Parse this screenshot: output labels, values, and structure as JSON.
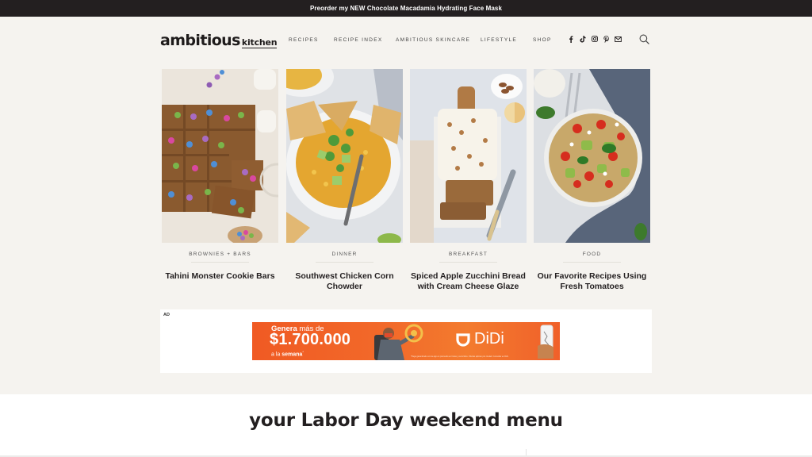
{
  "promo_bar": {
    "text": "Preorder my NEW Chocolate Macadamia Hydrating Face Mask"
  },
  "header": {
    "logo": {
      "primary": "ambitious",
      "secondary": "kitchen"
    },
    "nav": [
      {
        "label": "RECIPES"
      },
      {
        "label": "RECIPE INDEX"
      },
      {
        "label": "AMBITIOUS SKINCARE"
      },
      {
        "label": "LIFESTYLE"
      },
      {
        "label": "SHOP"
      }
    ],
    "social_icons": [
      "facebook-icon",
      "tiktok-icon",
      "instagram-icon",
      "pinterest-icon",
      "email-icon"
    ],
    "search_icon": "search-icon"
  },
  "recipes": [
    {
      "category": "BROWNIES + BARS",
      "title": "Tahini Monster Cookie Bars",
      "image": "monster cookie bars with candy"
    },
    {
      "category": "DINNER",
      "title": "Southwest Chicken Corn Chowder",
      "image": "corn chowder bowl with tortilla chips"
    },
    {
      "category": "BREAKFAST",
      "title": "Spiced Apple Zucchini Bread with Cream Cheese Glaze",
      "image": "zucchini bread loaf with glaze"
    },
    {
      "category": "FOOD",
      "title": "Our Favorite Recipes Using Fresh Tomatoes",
      "image": "pasta salad with tomatoes"
    }
  ],
  "ad": {
    "label": "AD",
    "headline_bold": "Genera",
    "headline_rest": " más de",
    "amount": "$1.700.000",
    "sub_normal": "a la ",
    "sub_bold": "semana",
    "sub_mark": "*",
    "brand": "DiDi",
    "fine_print": "*Pago garantizado con la app en promedio en horas y recorridos. Ofertas aplican por ciudad. Consultar en Didi."
  },
  "section": {
    "heading": "your Labor Day weekend menu"
  },
  "colors": {
    "promo_bg": "#231f20",
    "page_bg": "#f5f3ef",
    "ad_orange": "#f26a2a"
  }
}
